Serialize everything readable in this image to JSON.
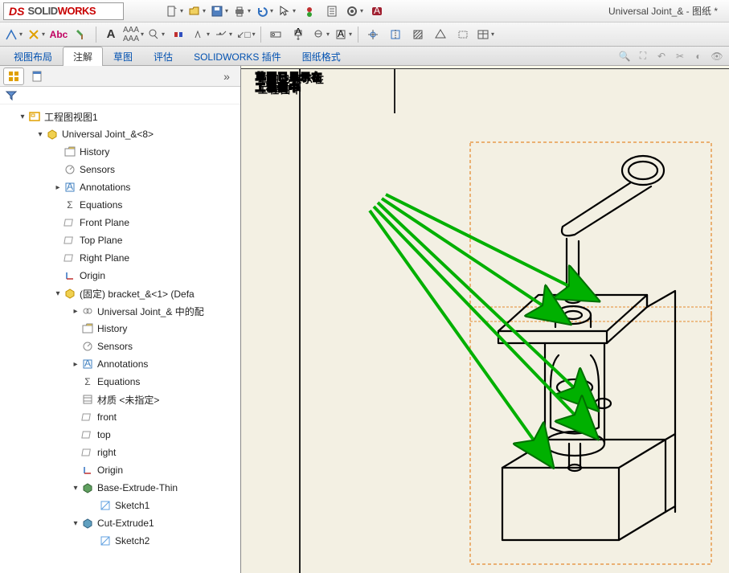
{
  "app": {
    "logo_solid": "SOLID",
    "logo_works": "WORKS",
    "doc_title": "Universal Joint_& - 图纸 *"
  },
  "tabs": {
    "view_layout": "视图布局",
    "annotate": "注解",
    "sketch": "草图",
    "evaluate": "评估",
    "addins": "SOLIDWORKS 插件",
    "sheet_format": "图纸格式"
  },
  "tree": {
    "root": "工程图视图1",
    "assy": "Universal Joint_&<8>",
    "history": "History",
    "sensors": "Sensors",
    "annotations": "Annotations",
    "equations": "Equations",
    "front_plane": "Front Plane",
    "top_plane": "Top Plane",
    "right_plane": "Right Plane",
    "origin": "Origin",
    "bracket": "(固定) bracket_&<1> (Defa",
    "mates": "Universal Joint_& 中的配",
    "history2": "History",
    "sensors2": "Sensors",
    "annotations2": "Annotations",
    "equations2": "Equations",
    "material": "材质 <未指定>",
    "front": "front",
    "top": "top",
    "right": "right",
    "origin2": "Origin",
    "base_extrude": "Base-Extrude-Thin",
    "sketch1": "Sketch1",
    "cut_extrude": "Cut-Extrude1",
    "sketch2": "Sketch2"
  },
  "overlay": {
    "line1": "草图已显示在",
    "line2": "工程图中"
  }
}
